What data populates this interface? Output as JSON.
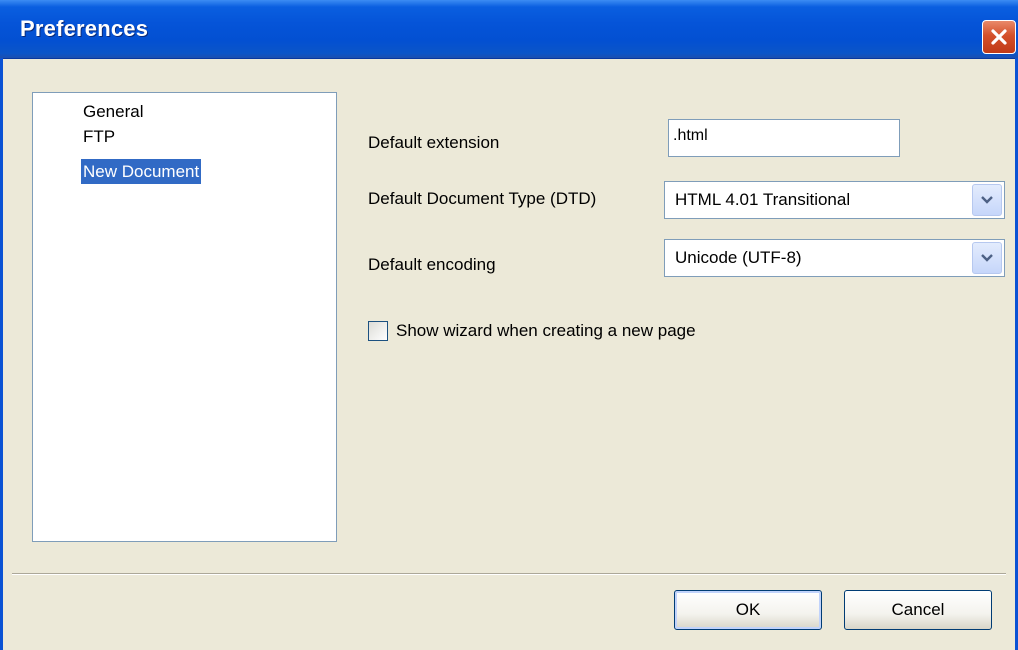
{
  "window": {
    "title": "Preferences"
  },
  "tree": {
    "items": [
      {
        "label": "General",
        "selected": false
      },
      {
        "label": "FTP",
        "selected": false
      },
      {
        "label": "New Document",
        "selected": true
      }
    ]
  },
  "form": {
    "default_extension": {
      "label": "Default extension",
      "value": ".html"
    },
    "default_dtd": {
      "label": "Default Document Type (DTD)",
      "selected": "HTML 4.01 Transitional"
    },
    "default_encoding": {
      "label": "Default encoding",
      "selected": "Unicode (UTF-8)"
    },
    "show_wizard": {
      "label": "Show wizard when creating a new page",
      "checked": false
    }
  },
  "buttons": {
    "ok": "OK",
    "cancel": "Cancel"
  },
  "colors": {
    "titlebar": "#0554d8",
    "selection": "#316ac5",
    "dialog_bg": "#ece9d8",
    "close": "#d4502a"
  }
}
